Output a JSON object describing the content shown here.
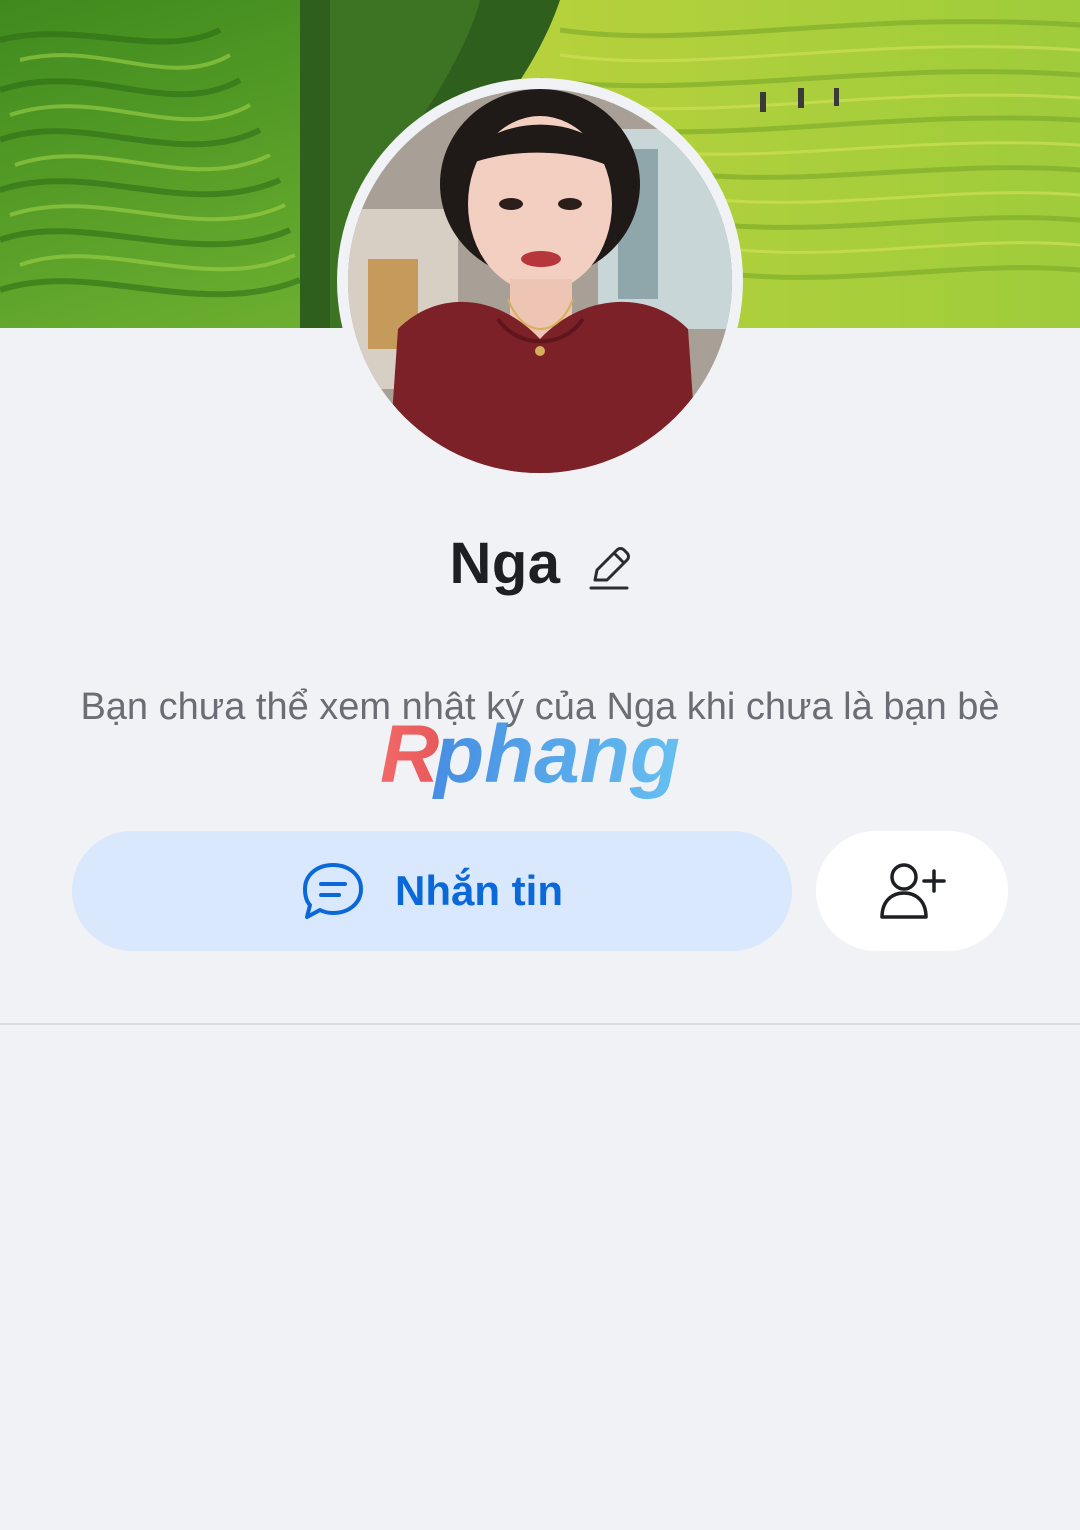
{
  "profile": {
    "name": "Nga",
    "notice": "Bạn chưa thể xem nhật ký của Nga khi chưa là bạn bè"
  },
  "actions": {
    "message_label": "Nhắn tin",
    "message_icon": "chat-bubble-icon",
    "add_friend_icon": "person-add-icon",
    "edit_icon": "pencil-icon"
  },
  "watermark": {
    "text": "Rphang"
  },
  "colors": {
    "background": "#f0f2f6",
    "accent": "#0a68d9",
    "message_button_bg": "#d9e8fc",
    "add_button_bg": "#ffffff"
  }
}
